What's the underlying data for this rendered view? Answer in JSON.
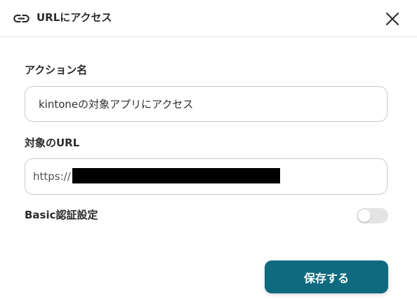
{
  "dialog": {
    "title": "URLにアクセス",
    "title_icon": "link-icon",
    "close_icon": "close-icon"
  },
  "form": {
    "action_name": {
      "label": "アクション名",
      "value": "kintoneの対象アプリにアクセス"
    },
    "target_url": {
      "label": "対象のURL",
      "value": "https://"
    },
    "basic_auth": {
      "label": "Basic認証設定",
      "enabled": false
    }
  },
  "footer": {
    "save_label": "保存する"
  },
  "colors": {
    "primary": "#0f6a7f",
    "toggle_off": "#e4e4e4"
  }
}
